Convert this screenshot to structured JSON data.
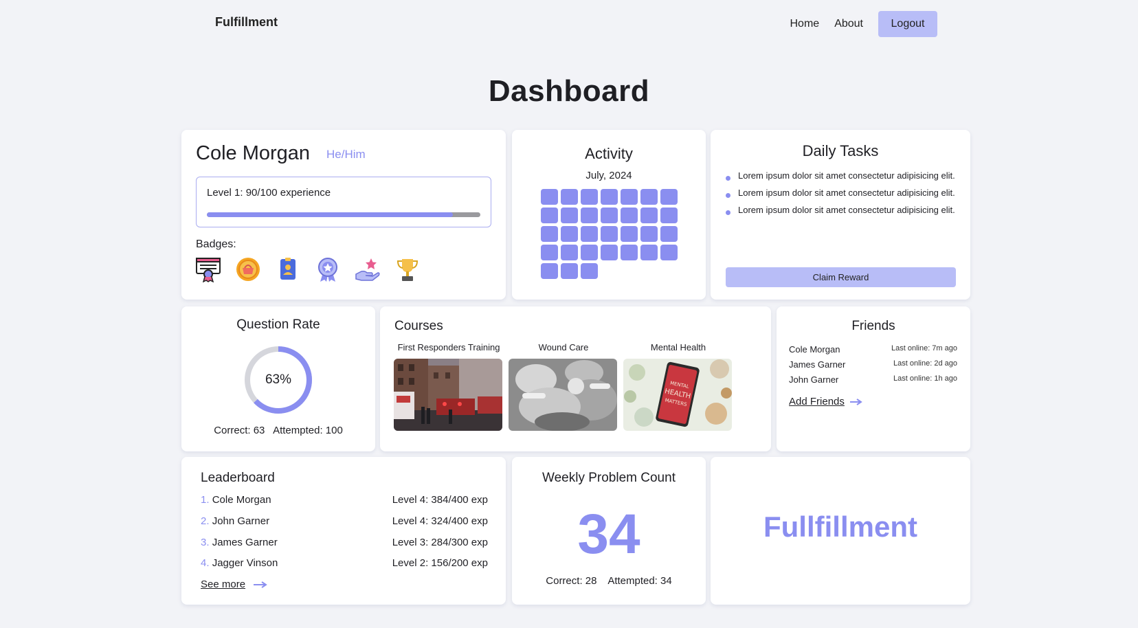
{
  "nav": {
    "brand": "Fulfillment",
    "links": [
      "Home",
      "About"
    ],
    "logout": "Logout"
  },
  "page_title": "Dashboard",
  "profile": {
    "name": "Cole Morgan",
    "pronouns": "He/Him",
    "level_text": "Level 1: 90/100 experience",
    "progress": 0.9,
    "badges_label": "Badges:",
    "badges": [
      "certificate-badge-icon",
      "basket-medal-icon",
      "id-card-icon",
      "rosette-star-icon",
      "hand-star-icon",
      "trophy-icon"
    ]
  },
  "activity": {
    "title": "Activity",
    "month": "July, 2024",
    "days": 31
  },
  "tasks": {
    "title": "Daily Tasks",
    "items": [
      "Lorem ipsum dolor sit amet consectetur adipisicing elit.",
      "Lorem ipsum dolor sit amet consectetur adipisicing elit.",
      "Lorem ipsum dolor sit amet consectetur adipisicing elit."
    ],
    "claim": "Claim Reward"
  },
  "question_rate": {
    "title": "Question Rate",
    "percent": "63%",
    "value": 0.63,
    "correct": "Correct: 63",
    "attempted": "Attempted: 100"
  },
  "courses": {
    "title": "Courses",
    "items": [
      {
        "name": "First Responders Training",
        "image": "street-scene"
      },
      {
        "name": "Wound Care",
        "image": "surgery-scene"
      },
      {
        "name": "Mental Health",
        "image": "mental-health-tablet"
      }
    ],
    "tablet_text": "MENTAL HEALTH MATTERS"
  },
  "friends": {
    "title": "Friends",
    "items": [
      {
        "name": "Cole Morgan",
        "online": "Last online: 7m ago"
      },
      {
        "name": "James Garner",
        "online": "Last online: 2d ago"
      },
      {
        "name": "John Garner",
        "online": "Last online: 1h ago"
      }
    ],
    "add": "Add Friends"
  },
  "leaderboard": {
    "title": "Leaderboard",
    "rows": [
      {
        "rank": "1.",
        "name": "Cole Morgan",
        "level": "Level 4: 384/400 exp"
      },
      {
        "rank": "2.",
        "name": "John Garner",
        "level": "Level 4: 324/400 exp"
      },
      {
        "rank": "3.",
        "name": "James Garner",
        "level": "Level 3: 284/300 exp"
      },
      {
        "rank": "4.",
        "name": "Jagger Vinson",
        "level": "Level 2: 156/200 exp"
      }
    ],
    "see_more": "See more"
  },
  "weekly": {
    "title": "Weekly Problem Count",
    "count": "34",
    "correct": "Correct: 28",
    "attempted": "Attempted: 34"
  },
  "brand_card": {
    "logo": "Fullfillment"
  },
  "colors": {
    "accent": "#8a8ef0",
    "accent_light": "#b8bdf7",
    "background": "#f2f3f7",
    "track": "#d5d6dc"
  }
}
